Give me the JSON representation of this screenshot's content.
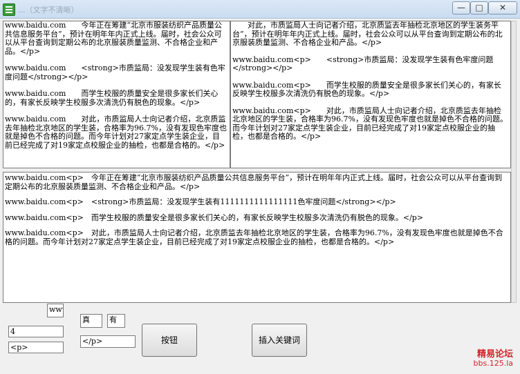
{
  "window": {
    "title": "...（文字不清晰）",
    "minimize_label": "—",
    "maximize_label": "□",
    "close_label": "✕"
  },
  "textbox1": {
    "paragraphs": [
      "www.baidu.com　　今年正在筹建“北京市服装纺织产品质量公共信息服务平台”，预计在明年年内正式上线。届时，社会公众可以从平台查询到定期公布的北京服装质量监测、不合格企业和产品。</p>",
      "www.baidu.com　　<strong>市质监局：没发现学生装有色牢度问题</strong></p>",
      "www.baidu.com　　而学生校服的质量安全是很多家长们关心的，有家长反映学生校服多次清洗仍有脱色的现象。</p>",
      "www.baidu.com　　对此，市质监局人士向记者介绍，北京质监去年抽检北京地区的学生装，合格率为96.7%，没有发现色牢度也就是掉色不合格的问题。而今年计划对27家定点学生装企业，目前已经完成了对19家定点校服企业的抽检，也都是合格的。</p>"
    ]
  },
  "textbox2": {
    "paragraphs": [
      "　　对此，市质监局人士向记者介绍，北京质监去年抽检北京地区的学生装务平台”，预计在明年年内正式上线。届时，社会公众可以从平台查询到定期公布的北京服装质量监测、不合格企业和产品。</p>",
      "www.baidu.com<p>　　<strong>市质监局：没发现学生装有色牢度问题</strong></p>",
      "www.baidu.com<p>　　而学生校服的质量安全是很多家长们关心的，有家长反映学生校服多次清洗仍有脱色的现象。</p>",
      "www.baidu.com<p>　　对此，市质监局人士向记者介绍，北京质监去年抽检北京地区的学生装，合格率为96.7%，没有发现色牢度也就是掉色不合格的问题。而今年计划对27家定点学生装企业，目前已经完成了对19家定点校服企业的抽检，也都是合格的。</p>"
    ]
  },
  "textbox3": {
    "paragraphs": [
      "www.baidu.com<p>　今年正在筹建“北京市服装纺织产品质量公共信息服务平台”，预计在明年年内正式上线。届时，社会公众可以从平台查询到定期公布的北京服装质量监测、不合格企业和产品。</p>",
      "www.baidu.com<p>　<strong>市质监局：没发现学生装有1111111111111111色牢度问题</strong></p>",
      "www.baidu.com<p>　而学生校服的质量安全是很多家长们关心的，有家长反映学生校服多次清洗仍有脱色的现象。</p>",
      "www.baidu.com<p>　对此，市质监局人士向记者介绍，北京质监去年抽检北京地区的学生装，合格率为96.7%，没有发现色牢度也就是掉色不合格的问题。而今年计划对27家定点学生装企业，目前已经完成了对19家定点校服企业的抽检，也都是合格的。</p>"
    ]
  },
  "controls": {
    "www_field": "www",
    "number_field": "4",
    "p_open_field": "<p>",
    "true_field": "真",
    "have_field": "有",
    "p_close_field": "</p>",
    "button_label": "按钮",
    "insert_keyword_label": "插入关键词"
  },
  "watermark": {
    "line1": "精易论坛",
    "line2": "bbs.125.la"
  }
}
